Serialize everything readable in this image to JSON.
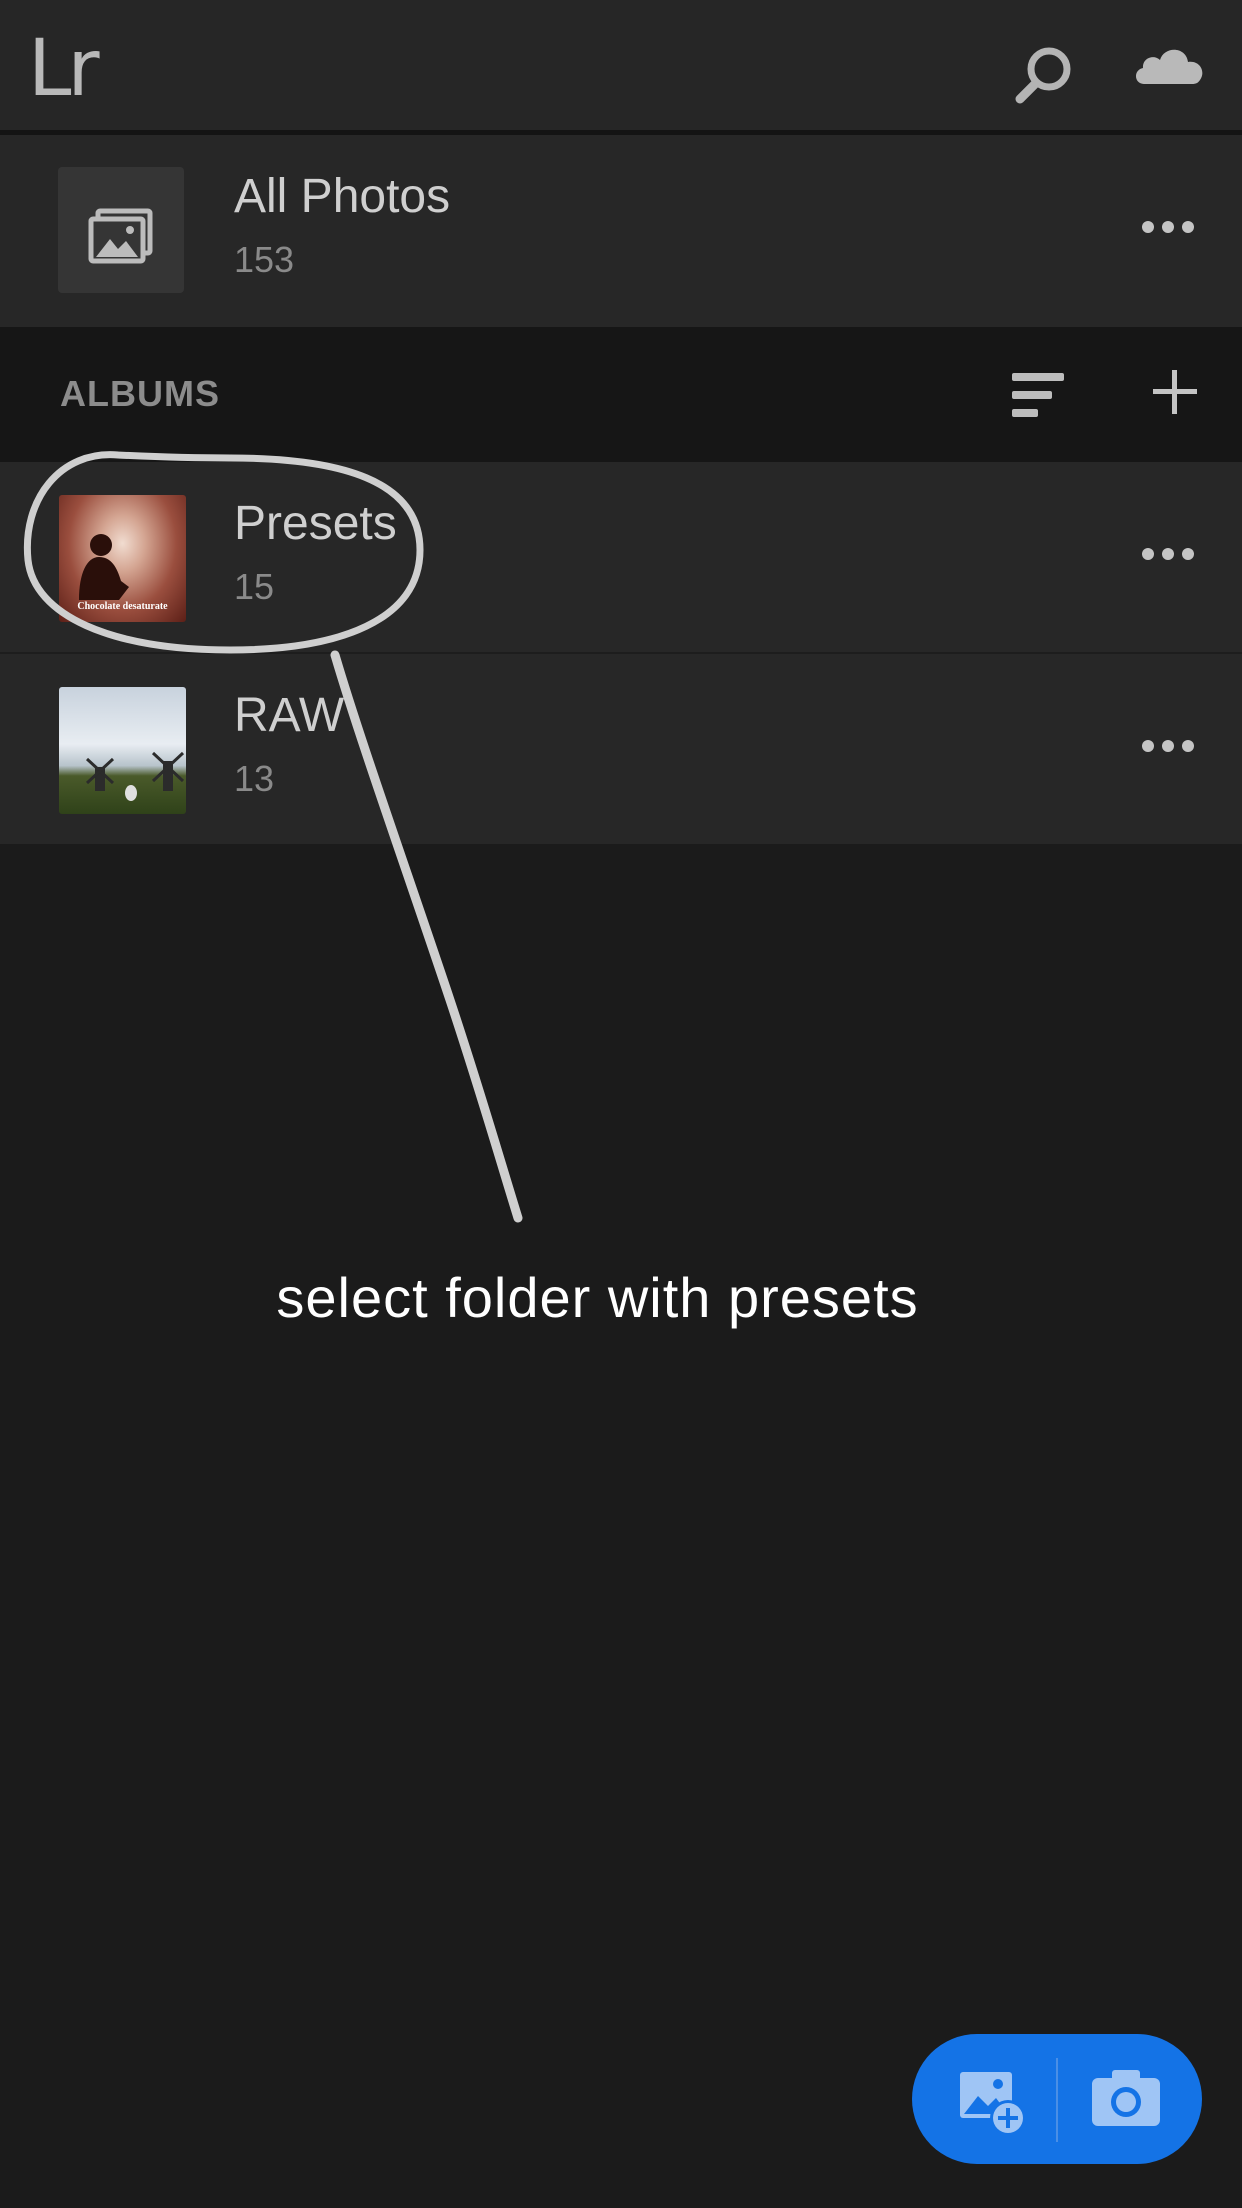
{
  "app": {
    "logo_text": "Lr"
  },
  "header": {
    "search_icon": "search-icon",
    "cloud_icon": "cloud-icon"
  },
  "all_photos": {
    "title": "All Photos",
    "count": "153",
    "icon": "photos-icon"
  },
  "albums_section": {
    "label": "ALBUMS",
    "sort_icon": "sort-icon",
    "add_icon": "plus-icon"
  },
  "albums": [
    {
      "title": "Presets",
      "count": "15",
      "thumb_caption": "Chocolate desaturate"
    },
    {
      "title": "RAW",
      "count": "13"
    }
  ],
  "annotation": {
    "instruction": "select folder with presets"
  },
  "fab": {
    "import_icon": "add-photo-icon",
    "camera_icon": "camera-icon",
    "color": "#1473e6"
  },
  "colors": {
    "background": "#1b1b1b",
    "header": "#262626",
    "row": "#272727",
    "accent": "#1473e6"
  }
}
